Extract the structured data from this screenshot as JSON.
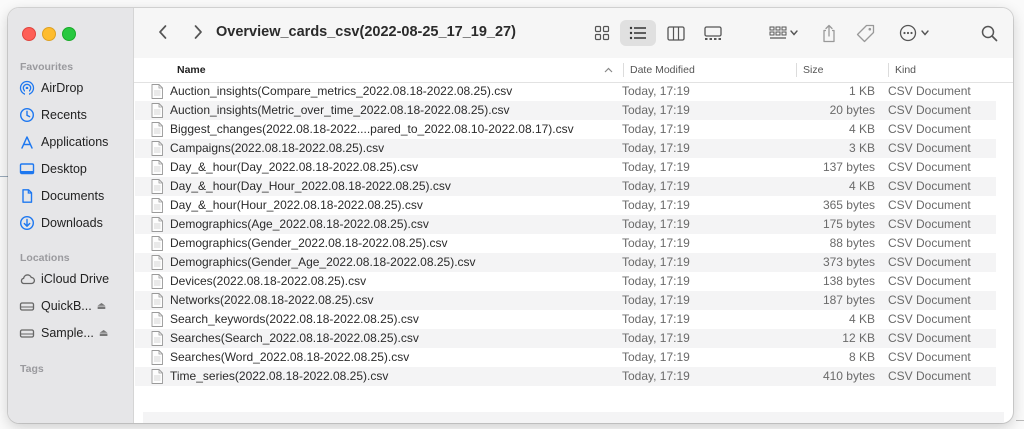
{
  "window": {
    "title": "Overview_cards_csv(2022-08-25_17_19_27)"
  },
  "sidebar": {
    "favourites_label": "Favourites",
    "favourites": [
      {
        "label": "AirDrop",
        "icon": "airdrop-icon"
      },
      {
        "label": "Recents",
        "icon": "clock-icon"
      },
      {
        "label": "Applications",
        "icon": "applications-icon"
      },
      {
        "label": "Desktop",
        "icon": "desktop-icon"
      },
      {
        "label": "Documents",
        "icon": "document-icon"
      },
      {
        "label": "Downloads",
        "icon": "download-icon"
      }
    ],
    "locations_label": "Locations",
    "locations": [
      {
        "label": "iCloud Drive",
        "icon": "cloud-icon"
      },
      {
        "label": "QuickB...",
        "icon": "drive-icon",
        "eject": true
      },
      {
        "label": "Sample...",
        "icon": "drive-icon",
        "eject": true
      }
    ],
    "tags_label": "Tags",
    "accent_color": "#1e78f0"
  },
  "toolbar": {
    "buttons": [
      "back-icon",
      "forward-icon",
      "icon-view-icon",
      "list-view-icon",
      "column-view-icon",
      "gallery-view-icon",
      "group-icon",
      "share-icon",
      "tag-icon",
      "more-icon",
      "search-icon"
    ],
    "active_view": "list"
  },
  "columns": {
    "name": "Name",
    "date": "Date Modified",
    "size": "Size",
    "kind": "Kind"
  },
  "files": [
    {
      "name": "Auction_insights(Compare_metrics_2022.08.18-2022.08.25).csv",
      "date": "Today, 17:19",
      "size": "1 KB",
      "kind": "CSV Document"
    },
    {
      "name": "Auction_insights(Metric_over_time_2022.08.18-2022.08.25).csv",
      "date": "Today, 17:19",
      "size": "20 bytes",
      "kind": "CSV Document"
    },
    {
      "name": "Biggest_changes(2022.08.18-2022....pared_to_2022.08.10-2022.08.17).csv",
      "date": "Today, 17:19",
      "size": "4 KB",
      "kind": "CSV Document"
    },
    {
      "name": "Campaigns(2022.08.18-2022.08.25).csv",
      "date": "Today, 17:19",
      "size": "3 KB",
      "kind": "CSV Document"
    },
    {
      "name": "Day_&_hour(Day_2022.08.18-2022.08.25).csv",
      "date": "Today, 17:19",
      "size": "137 bytes",
      "kind": "CSV Document"
    },
    {
      "name": "Day_&_hour(Day_Hour_2022.08.18-2022.08.25).csv",
      "date": "Today, 17:19",
      "size": "4 KB",
      "kind": "CSV Document"
    },
    {
      "name": "Day_&_hour(Hour_2022.08.18-2022.08.25).csv",
      "date": "Today, 17:19",
      "size": "365 bytes",
      "kind": "CSV Document"
    },
    {
      "name": "Demographics(Age_2022.08.18-2022.08.25).csv",
      "date": "Today, 17:19",
      "size": "175 bytes",
      "kind": "CSV Document"
    },
    {
      "name": "Demographics(Gender_2022.08.18-2022.08.25).csv",
      "date": "Today, 17:19",
      "size": "88 bytes",
      "kind": "CSV Document"
    },
    {
      "name": "Demographics(Gender_Age_2022.08.18-2022.08.25).csv",
      "date": "Today, 17:19",
      "size": "373 bytes",
      "kind": "CSV Document"
    },
    {
      "name": "Devices(2022.08.18-2022.08.25).csv",
      "date": "Today, 17:19",
      "size": "138 bytes",
      "kind": "CSV Document"
    },
    {
      "name": "Networks(2022.08.18-2022.08.25).csv",
      "date": "Today, 17:19",
      "size": "187 bytes",
      "kind": "CSV Document"
    },
    {
      "name": "Search_keywords(2022.08.18-2022.08.25).csv",
      "date": "Today, 17:19",
      "size": "4 KB",
      "kind": "CSV Document"
    },
    {
      "name": "Searches(Search_2022.08.18-2022.08.25).csv",
      "date": "Today, 17:19",
      "size": "12 KB",
      "kind": "CSV Document"
    },
    {
      "name": "Searches(Word_2022.08.18-2022.08.25).csv",
      "date": "Today, 17:19",
      "size": "8 KB",
      "kind": "CSV Document"
    },
    {
      "name": "Time_series(2022.08.18-2022.08.25).csv",
      "date": "Today, 17:19",
      "size": "410 bytes",
      "kind": "CSV Document"
    }
  ]
}
